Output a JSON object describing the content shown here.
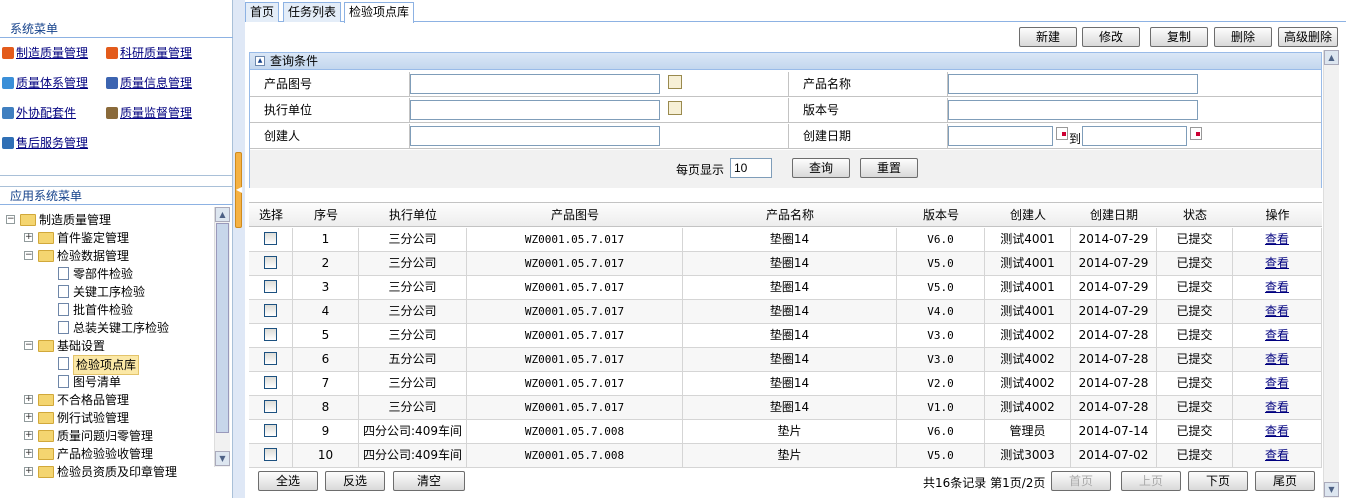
{
  "sidebar": {
    "system_menu_title": "系统菜单",
    "menu_items": [
      {
        "label": "制造质量管理",
        "icon": "office-icon",
        "color": "#e35b1b"
      },
      {
        "label": "科研质量管理",
        "icon": "office-icon",
        "color": "#e35b1b"
      },
      {
        "label": "质量体系管理",
        "icon": "network-icon",
        "color": "#3a8fd8"
      },
      {
        "label": "质量信息管理",
        "icon": "chart-icon",
        "color": "#3c64b0"
      },
      {
        "label": "外协配套件",
        "icon": "package-icon",
        "color": "#3f7fc0"
      },
      {
        "label": "质量监督管理",
        "icon": "person-icon",
        "color": "#8a6a3a"
      },
      {
        "label": "售后服务管理",
        "icon": "book-icon",
        "color": "#2f6fb5"
      }
    ],
    "app_menu_title": "应用系统菜单",
    "tree": [
      {
        "label": "制造质量管理",
        "toggle": "−",
        "type": "folder",
        "level": 0
      },
      {
        "label": "首件鉴定管理",
        "toggle": "+",
        "type": "folder",
        "level": 1
      },
      {
        "label": "检验数据管理",
        "toggle": "−",
        "type": "folder",
        "level": 1
      },
      {
        "label": "零部件检验",
        "toggle": "",
        "type": "file",
        "level": 2
      },
      {
        "label": "关键工序检验",
        "toggle": "",
        "type": "file",
        "level": 2
      },
      {
        "label": "批首件检验",
        "toggle": "",
        "type": "file",
        "level": 2
      },
      {
        "label": "总装关键工序检验",
        "toggle": "",
        "type": "file",
        "level": 2
      },
      {
        "label": "基础设置",
        "toggle": "−",
        "type": "folder",
        "level": 1
      },
      {
        "label": "检验项点库",
        "toggle": "",
        "type": "file",
        "level": 2,
        "selected": true
      },
      {
        "label": "图号清单",
        "toggle": "",
        "type": "file",
        "level": 2
      },
      {
        "label": "不合格品管理",
        "toggle": "+",
        "type": "folder",
        "level": 1
      },
      {
        "label": "例行试验管理",
        "toggle": "+",
        "type": "folder",
        "level": 1
      },
      {
        "label": "质量问题归零管理",
        "toggle": "+",
        "type": "folder",
        "level": 1
      },
      {
        "label": "产品检验验收管理",
        "toggle": "+",
        "type": "folder",
        "level": 1
      },
      {
        "label": "检验员资质及印章管理",
        "toggle": "+",
        "type": "folder",
        "level": 1
      }
    ]
  },
  "tabs": [
    "首页",
    "任务列表",
    "检验项点库"
  ],
  "toolbar": [
    "新建",
    "修改",
    "复制",
    "删除",
    "高级删除"
  ],
  "query": {
    "title": "查询条件",
    "labels": {
      "product_drawing_no": "产品图号",
      "product_name": "产品名称",
      "exec_unit": "执行单位",
      "version": "版本号",
      "creator": "创建人",
      "created_date": "创建日期",
      "to": "到"
    },
    "page_size_label": "每页显示",
    "page_size": "10",
    "search_label": "查询",
    "reset_label": "重置"
  },
  "grid": {
    "headers": [
      "选择",
      "序号",
      "执行单位",
      "产品图号",
      "产品名称",
      "版本号",
      "创建人",
      "创建日期",
      "状态",
      "操作"
    ],
    "rows": [
      [
        "1",
        "三分公司",
        "WZ0001.05.7.017",
        "垫圈14",
        "V6.0",
        "测试4001",
        "2014-07-29",
        "已提交",
        "查看"
      ],
      [
        "2",
        "三分公司",
        "WZ0001.05.7.017",
        "垫圈14",
        "V5.0",
        "测试4001",
        "2014-07-29",
        "已提交",
        "查看"
      ],
      [
        "3",
        "三分公司",
        "WZ0001.05.7.017",
        "垫圈14",
        "V5.0",
        "测试4001",
        "2014-07-29",
        "已提交",
        "查看"
      ],
      [
        "4",
        "三分公司",
        "WZ0001.05.7.017",
        "垫圈14",
        "V4.0",
        "测试4001",
        "2014-07-29",
        "已提交",
        "查看"
      ],
      [
        "5",
        "三分公司",
        "WZ0001.05.7.017",
        "垫圈14",
        "V3.0",
        "测试4002",
        "2014-07-28",
        "已提交",
        "查看"
      ],
      [
        "6",
        "五分公司",
        "WZ0001.05.7.017",
        "垫圈14",
        "V3.0",
        "测试4002",
        "2014-07-28",
        "已提交",
        "查看"
      ],
      [
        "7",
        "三分公司",
        "WZ0001.05.7.017",
        "垫圈14",
        "V2.0",
        "测试4002",
        "2014-07-28",
        "已提交",
        "查看"
      ],
      [
        "8",
        "三分公司",
        "WZ0001.05.7.017",
        "垫圈14",
        "V1.0",
        "测试4002",
        "2014-07-28",
        "已提交",
        "查看"
      ],
      [
        "9",
        "四分公司:409车间",
        "WZ0001.05.7.008",
        "垫片",
        "V6.0",
        "管理员",
        "2014-07-14",
        "已提交",
        "查看"
      ],
      [
        "10",
        "四分公司:409车间",
        "WZ0001.05.7.008",
        "垫片",
        "V5.0",
        "测试3003",
        "2014-07-02",
        "已提交",
        "查看"
      ]
    ]
  },
  "pager": {
    "select_all": "全选",
    "invert": "反选",
    "clear": "清空",
    "summary": "共16条记录 第1页/2页",
    "first": "首页",
    "prev": "上页",
    "next": "下页",
    "last": "尾页"
  }
}
